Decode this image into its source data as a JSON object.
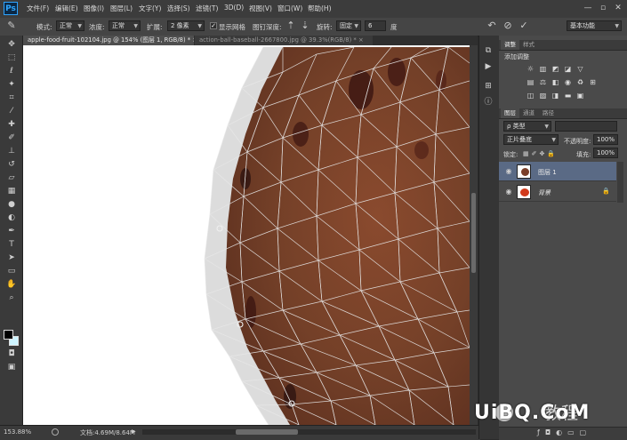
{
  "app": {
    "logo": "Ps"
  },
  "menu": [
    "文件(F)",
    "编辑(E)",
    "图像(I)",
    "图层(L)",
    "文字(Y)",
    "选择(S)",
    "滤镜(T)",
    "3D(D)",
    "视图(V)",
    "窗口(W)",
    "帮助(H)"
  ],
  "window_controls": {
    "minimize": "—",
    "maximize": "▫",
    "close": "✕"
  },
  "options": {
    "mode_label": "模式:",
    "mode_value": "正常",
    "density_label": "浓度:",
    "density_value": "正常",
    "expand_label": "扩展:",
    "expand_value": "2 像素",
    "show_mesh_label": "显示网格",
    "show_mesh_checked": true,
    "pin_depth_label": "图钉深度:",
    "rotate_label": "旋转:",
    "rotate_value": "固定",
    "rotate_angle": "6",
    "rotate_unit": "度",
    "workspace": "基本功能"
  },
  "tabs": [
    {
      "label": "apple-food-fruit-102104.jpg @ 154% (图层 1, RGB/8) *",
      "active": true,
      "close": "×"
    },
    {
      "label": "action-ball-baseball-2667800.jpg @ 39.3%(RGB/8) *",
      "active": false,
      "close": "×"
    }
  ],
  "status": {
    "zoom": "153.88%",
    "doc": "文档:4.69M/8.64M"
  },
  "adjustments_panel": {
    "tab_active": "调整",
    "tab_inactive": "样式",
    "title": "添加调整"
  },
  "layers_panel": {
    "tabs": [
      "图层",
      "通道",
      "路径"
    ],
    "filter_label": "ρ 类型",
    "blend_mode": "正片叠底",
    "opacity_label": "不透明度:",
    "opacity_value": "100%",
    "lock_label": "锁定:",
    "fill_label": "填充:",
    "fill_value": "100%",
    "layers": [
      {
        "name": "图层 1",
        "selected": true
      },
      {
        "name": "背景",
        "selected": false
      }
    ]
  },
  "watermark": {
    "logo": "UiBQ.CoM",
    "text": "教程"
  },
  "colors": {
    "accent": "#31a8ff",
    "panel": "#4a4a4a",
    "selected_layer": "#5a6a85"
  }
}
